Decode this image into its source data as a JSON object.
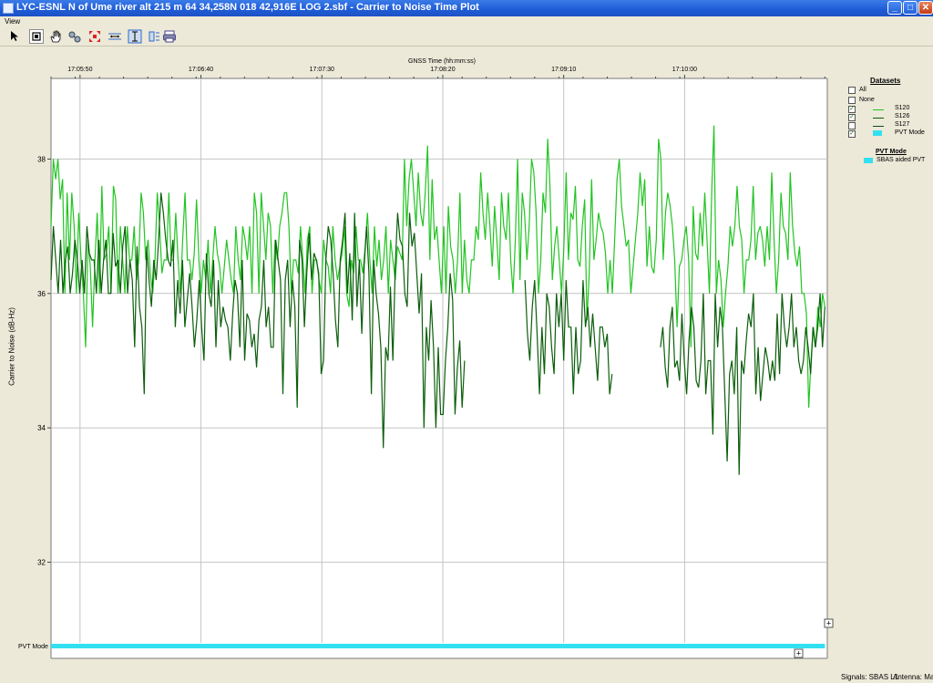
{
  "window": {
    "title": "LYC-ESNL N of Ume river alt 215 m 64 34,258N 018 42,916E LOG 2.sbf - Carrier to Noise Time Plot",
    "minimize": "_",
    "maximize": "□",
    "close": "✕"
  },
  "menu": {
    "view": "View"
  },
  "toolbar": {
    "icons": [
      "select-arrow-icon",
      "zoom-box-icon",
      "pan-hand-icon",
      "measure-icon",
      "fit-all-icon",
      "x-range-icon",
      "y-range-icon",
      "settings-icon",
      "print-icon"
    ]
  },
  "axes": {
    "x_title": "GNSS Time (hh:mm:ss)",
    "y_title": "Carrier to Noise (dB-Hz)",
    "pvt_row_label": "PVT Mode"
  },
  "legend": {
    "datasets_title": "Datasets",
    "all_label": "All",
    "none_label": "None",
    "items": [
      {
        "name": "S120",
        "checked": true,
        "color": "#22c422"
      },
      {
        "name": "S126",
        "checked": true,
        "color": "#0b5e0b"
      },
      {
        "name": "S127",
        "checked": false,
        "color": "#0f4a2a"
      },
      {
        "name": "PVT Mode",
        "checked": true,
        "color": "#33e0f0"
      }
    ],
    "pvt_title": "PVT Mode",
    "pvt_items": [
      {
        "name": "SBAS aided PVT",
        "color": "#33e0f0"
      }
    ]
  },
  "chart_data": {
    "type": "line",
    "x_unit": "seconds after 17:05:38",
    "x_range": [
      "17:05:38",
      "17:10:59"
    ],
    "ylim": [
      30.8,
      39.2
    ],
    "y_ticks": [
      32,
      34,
      36,
      38
    ],
    "x_ticks": [
      "17:05:50",
      "17:06:40",
      "17:07:30",
      "17:08:20",
      "17:09:10",
      "17:10:00"
    ],
    "grid": true,
    "series": [
      {
        "name": "S120",
        "color": "#22c422",
        "values": [
          37,
          38,
          37.7,
          38,
          37.4,
          37.7,
          36,
          37.5,
          36.5,
          37.5,
          37,
          36,
          37.2,
          36.5,
          36,
          35.2,
          36.8,
          36.4,
          35.5,
          36.5,
          37.2,
          36,
          37.6,
          36.5,
          36.6,
          37,
          36,
          37.6,
          37.4,
          36,
          37,
          36.5,
          36,
          37,
          36.5,
          36.5,
          37,
          36.2,
          36.5,
          37.5,
          37.2,
          36.5,
          36.8,
          36.3,
          36,
          36.5,
          37.5,
          37,
          36.3,
          36.5,
          36.5,
          37.5,
          36.5,
          36.5,
          37.2,
          36.5,
          36,
          36.8,
          37.5,
          36.5,
          36.5,
          36.2,
          36.6,
          37.4,
          36.5,
          36,
          36.5,
          36.2,
          36.8,
          36,
          36.5,
          37,
          36.6,
          36.4,
          36,
          36.4,
          36.8,
          36.5,
          36.2,
          36,
          37,
          36.5,
          36.2,
          37,
          36.8,
          36.5,
          37,
          36,
          37.5,
          37.2,
          36,
          37.5,
          37,
          36.5,
          37.2,
          37,
          36,
          36.8,
          36.5,
          37,
          37.2,
          37.5,
          37.5,
          37,
          36,
          36.5,
          36.5,
          36.3,
          37,
          36.5,
          36,
          36.8,
          37,
          36,
          36.5,
          36.5,
          36.2,
          36,
          36.8,
          36.5,
          36.4,
          36,
          37,
          36.5,
          36.2,
          36.4,
          36.6,
          37,
          36,
          35.8,
          36.5,
          36.3,
          37,
          36.5,
          36.5,
          36.3,
          36.7,
          37.2,
          36.5,
          36,
          37,
          36.4,
          36.8,
          36.2,
          36.5,
          37,
          36,
          36.8,
          36.5,
          36.2,
          36.7,
          36.6,
          36.5,
          38,
          37,
          37.7,
          38,
          37.5,
          37,
          37.8,
          37.2,
          37,
          37.5,
          38.2,
          36.5,
          37.7,
          36.8,
          37,
          36.5,
          36,
          37,
          36,
          37.3,
          36.7,
          36.5,
          36,
          36.5,
          37.5,
          36,
          36.8,
          36.2,
          36,
          36.5,
          36.5,
          37,
          36.8,
          37.8,
          37.2,
          36.8,
          37.5,
          37,
          36.4,
          37.3,
          36.8,
          36.2,
          37.5,
          37,
          36.8,
          37.5,
          36.5,
          36,
          36.8,
          38,
          36.2,
          37.5,
          37.2,
          36.5,
          37,
          38,
          37.8,
          37.2,
          36,
          36.5,
          37.5,
          37.2,
          38.3,
          37.6,
          36.2,
          36.7,
          37,
          36.5,
          36,
          36.7,
          37.8,
          36.5,
          37.2,
          37.1,
          37.6,
          36.5,
          36.4,
          37,
          37.4,
          35.6,
          36.3,
          37.7,
          36.5,
          36.8,
          37.2,
          37,
          36.9,
          36.6,
          36,
          36.5,
          36,
          36.8,
          37.7,
          38,
          37.3,
          37,
          36.7,
          36.8,
          36,
          36.4,
          36.8,
          37.2,
          37.8,
          37.3,
          37.7,
          36.4,
          37,
          36.4,
          36.3,
          36.8,
          38.3,
          38,
          36.5,
          37.2,
          37.5,
          37.3,
          37,
          36.5,
          35.5,
          36.4,
          36.5,
          36.8,
          37,
          36.5,
          35.2,
          37.3,
          36.6,
          36.5,
          37.2,
          36.7,
          37.5,
          36.8,
          36,
          37.5,
          38.5,
          36,
          36.5,
          36.2,
          35.5,
          36,
          36.4,
          37,
          36.7,
          37,
          37.6,
          37,
          36.8,
          36,
          36.5,
          36.5,
          36.8,
          37.6,
          36.5,
          36.9,
          37,
          36.8,
          36.4,
          37,
          36.5,
          37.8,
          36.8,
          36,
          36.5,
          37.5,
          37,
          36.9,
          36.5,
          37.8,
          37,
          36.6,
          36.4,
          36.7,
          36,
          36,
          35.7,
          34.3,
          35,
          35.5,
          35.2,
          35.8,
          35.5,
          36,
          35.8
        ],
        "x_end": 320
      },
      {
        "name": "S126",
        "color": "#0b5e0b",
        "segments": [
          {
            "x_start": 0,
            "x_end": 171,
            "values": [
              36.2,
              37,
              36.5,
              36,
              36.8,
              36,
              36.5,
              36.7,
              36,
              36.3,
              36.8,
              36.5,
              36,
              36.5,
              36,
              37,
              36.6,
              36.5,
              36.5,
              36,
              36.8,
              36,
              36.5,
              36.8,
              36,
              36,
              36.9,
              36.4,
              36.5,
              36,
              36.7,
              37,
              36,
              36.5,
              36.2,
              35.2,
              36.7,
              35.8,
              35.5,
              34.5,
              36.7,
              36.2,
              35.8,
              36.5,
              36.2,
              36.8,
              37.5,
              37.2,
              36.8,
              36.5,
              36.4,
              36.8,
              35.5,
              36.2,
              35.7,
              36.5,
              35.5,
              35.9,
              36.3,
              35.8,
              35.2,
              35.6,
              36.2,
              35.5,
              35,
              36.6,
              36,
              35.8,
              36.5,
              35.2,
              36.2,
              35.5,
              35.8,
              35.6,
              35.5,
              35,
              35.7,
              36.2,
              36,
              35.2,
              36.5,
              35,
              35.7,
              35.6,
              35.2,
              35.4,
              34.9,
              35.6,
              35.8,
              36.5,
              35.5,
              35.8,
              35.2,
              35.2,
              36.8,
              36.5,
              36.2,
              34.5,
              36.2,
              36.5,
              35.5,
              36.2,
              35.8,
              34.3,
              36.8,
              36.5,
              35.5,
              36.3,
              36.9,
              36.2,
              36.6,
              36.5,
              36.3,
              34.8,
              35,
              36.5,
              37,
              36.8,
              36.3,
              35.6,
              35.2,
              36.5,
              36.8,
              37.2,
              36,
              36.6,
              35.6,
              37.2,
              35.8,
              36.5,
              35.4,
              36.4,
              37,
              36.3,
              34.5,
              36.5,
              36,
              35.7,
              35.2,
              33.7,
              35.2,
              35,
              36.1,
              35,
              36.4,
              37.2,
              36.8,
              36.7,
              36,
              35.8,
              37.2,
              36.7,
              36.9,
              36.3,
              35.7,
              36.3,
              34,
              35.5,
              35,
              35.9,
              35.2,
              34,
              35.2,
              34.2,
              34.2,
              35,
              35.5,
              36.3,
              35.9,
              34.2,
              34.9,
              35.3,
              34.3,
              35
            ]
          },
          {
            "x_start": 196,
            "x_end": 232,
            "values": [
              36.2,
              35.4,
              35,
              35.8,
              36.2,
              35.4,
              34.5,
              35.5,
              34.8,
              36,
              35.8,
              35.2,
              34.8,
              36,
              35.5,
              36,
              35,
              36.2,
              35.5,
              35.5,
              34.5,
              35.5,
              34.8,
              35,
              36.2,
              35.5,
              35.8,
              35.2,
              35.7,
              35.2,
              34.7,
              35.5,
              35.5,
              35.2,
              35.4,
              34.5,
              34.8
            ]
          },
          {
            "x_start": 252,
            "x_end": 320,
            "values": [
              35.2,
              35.5,
              34.9,
              34.6,
              35.5,
              35.8,
              34.9,
              35,
              34.7,
              35.7,
              35,
              34.5,
              35.3,
              35.8,
              35.5,
              34.7,
              34.6,
              35,
              36,
              34.5,
              35,
              35,
              33.9,
              36,
              35.2,
              35.8,
              35.5,
              34.5,
              33.5,
              34.8,
              35,
              34.5,
              35.5,
              33.3,
              35,
              34.8,
              35.3,
              35.7,
              35.5,
              36,
              34.5,
              35.2,
              34.4,
              34.8,
              35.2,
              35,
              34.7,
              35,
              34.7,
              35.7,
              34.8,
              36,
              35.5,
              35.2,
              35.5,
              36,
              35.2,
              35.5,
              35,
              34.8,
              35,
              35.5,
              35.2,
              34.8,
              35.5,
              35.2,
              35.5,
              36,
              35.2,
              35.8
            ]
          }
        ]
      }
    ],
    "pvt_mode": {
      "name": "SBAS aided PVT",
      "color": "#33e0f0",
      "x_range": [
        0,
        320
      ]
    }
  },
  "status": {
    "signals": "Signals: SBAS L1",
    "antenna": "Antenna: Main"
  }
}
